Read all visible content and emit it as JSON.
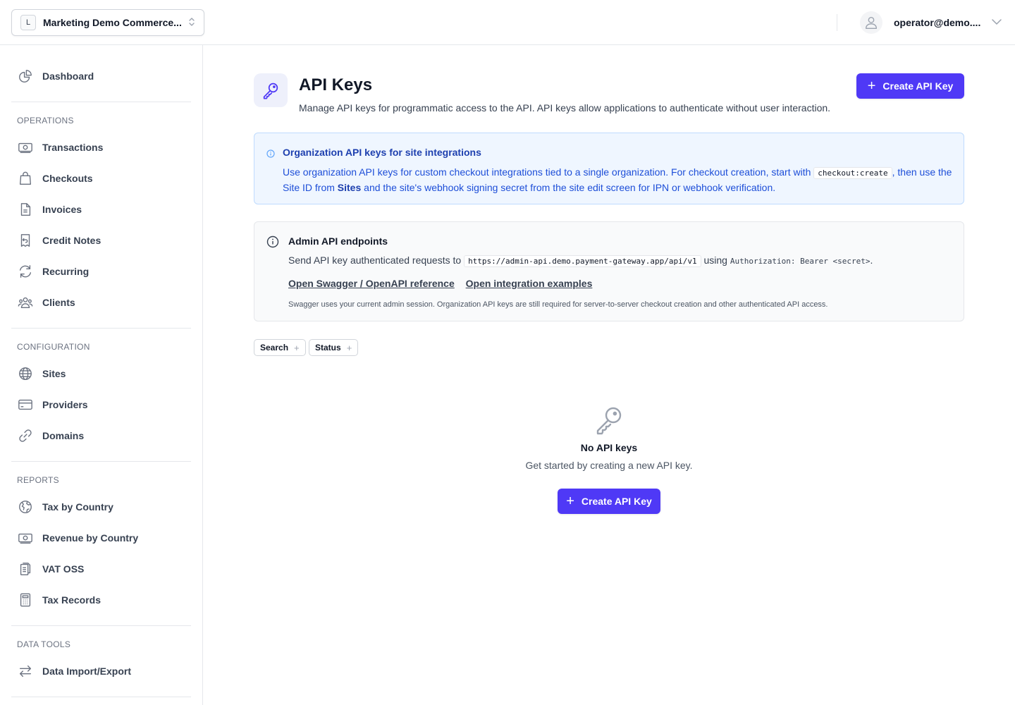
{
  "topbar": {
    "org_initial": "L",
    "org_name": "Marketing Demo Commerce...",
    "user_email": "operator@demo...."
  },
  "sidebar": {
    "dashboard": "Dashboard",
    "sections": [
      {
        "label": "OPERATIONS",
        "items": [
          {
            "label": "Transactions",
            "icon": "banknote-icon"
          },
          {
            "label": "Checkouts",
            "icon": "shopping-bag-icon"
          },
          {
            "label": "Invoices",
            "icon": "document-icon"
          },
          {
            "label": "Credit Notes",
            "icon": "receipt-refund-icon"
          },
          {
            "label": "Recurring",
            "icon": "refresh-icon"
          },
          {
            "label": "Clients",
            "icon": "users-icon"
          }
        ]
      },
      {
        "label": "CONFIGURATION",
        "items": [
          {
            "label": "Sites",
            "icon": "globe-icon"
          },
          {
            "label": "Providers",
            "icon": "credit-card-icon"
          },
          {
            "label": "Domains",
            "icon": "link-icon"
          }
        ]
      },
      {
        "label": "REPORTS",
        "items": [
          {
            "label": "Tax by Country",
            "icon": "globe-europe-icon"
          },
          {
            "label": "Revenue by Country",
            "icon": "banknote-icon"
          },
          {
            "label": "VAT OSS",
            "icon": "clipboard-document-icon"
          },
          {
            "label": "Tax Records",
            "icon": "calculator-icon"
          }
        ]
      },
      {
        "label": "DATA TOOLS",
        "items": [
          {
            "label": "Data Import/Export",
            "icon": "arrows-right-left-icon"
          }
        ]
      }
    ]
  },
  "main": {
    "title": "API Keys",
    "description": "Manage API keys for programmatic access to the API. API keys allow applications to authenticate without user interaction.",
    "create_button": "Create API Key",
    "org_info": {
      "title": "Organization API keys for site integrations",
      "text_1": "Use organization API keys for custom checkout integrations tied to a single organization. For checkout creation, start with",
      "code": "checkout:create",
      "text_2": ", then use the Site ID from",
      "sites_link": "Sites",
      "text_3": "and the site's webhook signing secret from the site edit screen for IPN or webhook verification."
    },
    "admin_info": {
      "title": "Admin API endpoints",
      "text_1": "Send API key authenticated requests to",
      "url": "https://admin-api.demo.payment-gateway.app/api/v1",
      "text_2": "using",
      "header_code": "Authorization: Bearer <secret>",
      "text_3": ".",
      "link_swagger": "Open Swagger / OpenAPI reference",
      "link_examples": "Open integration examples",
      "note": "Swagger uses your current admin session. Organization API keys are still required for server-to-server checkout creation and other authenticated API access."
    },
    "filters": {
      "search": "Search",
      "status": "Status"
    },
    "empty": {
      "title": "No API keys",
      "subtitle": "Get started by creating a new API key.",
      "button": "Create API Key"
    }
  },
  "colors": {
    "accent": "#4f39f6",
    "info_bg": "#eff6ff",
    "info_text": "#1d4ed8"
  }
}
